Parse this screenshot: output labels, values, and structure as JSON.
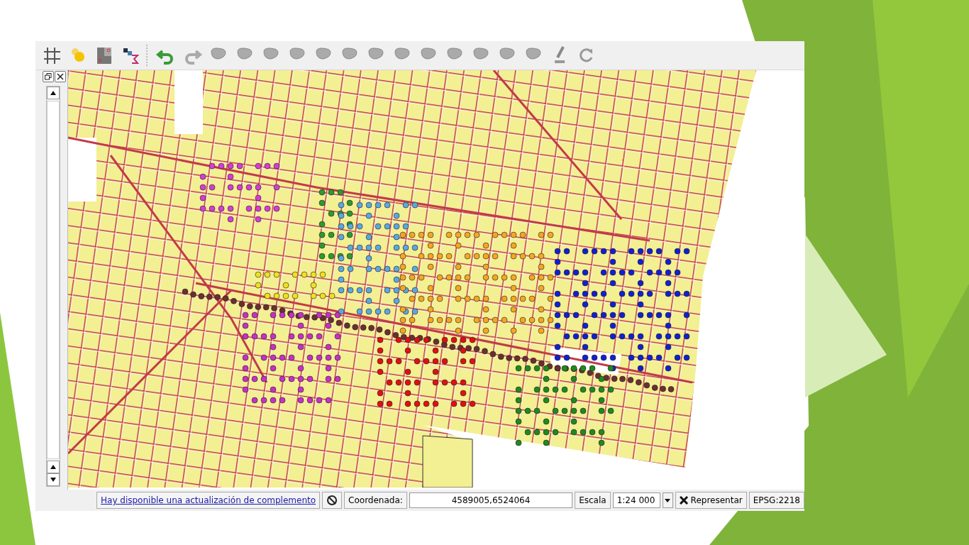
{
  "map": {
    "point_groups": [
      {
        "color": "#d63cd6"
      },
      {
        "color": "#2e9a2e"
      },
      {
        "color": "#5aa8e0"
      },
      {
        "color": "#f5a623"
      },
      {
        "color": "#1020d0"
      },
      {
        "color": "#6b2f2f"
      },
      {
        "color": "#f0e020"
      },
      {
        "color": "#e01010"
      },
      {
        "color": "#1e8a1e"
      },
      {
        "color": "#c630c6"
      }
    ]
  },
  "status_bar": {
    "plugin_update_link": "Hay disponible una actualización de complemento",
    "coordinate_label": "Coordenada:",
    "coordinate_value": "4589005,6524064",
    "scale_label": "Escala",
    "scale_value": "1:24 000",
    "render": {
      "label": "Representar",
      "checked": true
    },
    "crs": "EPSG:2218"
  }
}
